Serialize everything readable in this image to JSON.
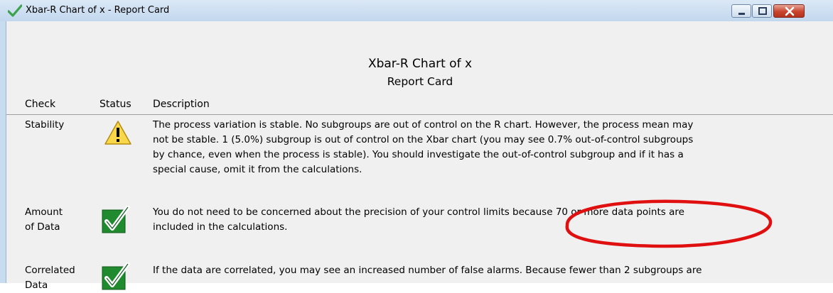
{
  "window": {
    "title": "Xbar-R Chart of x - Report Card"
  },
  "report": {
    "title": "Xbar-R Chart of x",
    "subtitle": "Report Card",
    "columns": {
      "check": "Check",
      "status": "Status",
      "description": "Description"
    },
    "rows": [
      {
        "check_line1": "Stability",
        "check_line2": "",
        "status_icon": "warning-icon",
        "description": [
          "The process variation is stable. No subgroups are out of control on the R chart. However, the process mean may",
          "not be stable. 1 (5.0%) subgroup is out of control on the Xbar chart (you may see 0.7% out-of-control subgroups",
          "by chance, even when the process is stable). You should investigate the out-of-control subgroup and if it has a",
          "special cause, omit it from the calculations."
        ]
      },
      {
        "check_line1": "Amount",
        "check_line2": "of Data",
        "status_icon": "checkmark-icon",
        "description": [
          "You do not need to be concerned about the precision of your control limits because 70 or more data points are",
          "included in the calculations."
        ]
      },
      {
        "check_line1": "Correlated",
        "check_line2": "Data",
        "status_icon": "checkmark-icon",
        "description": [
          "If the data are correlated, you may see an increased number of false alarms. Because fewer than 2 subgroups are"
        ]
      }
    ]
  },
  "colors": {
    "title_bar": "#c2d7ee",
    "client_bg": "#f0f0f0",
    "warning_yellow": "#f8d84a",
    "check_green": "#1f8a2e",
    "annotation_red": "#e01010",
    "close_button": "#c9442c"
  }
}
